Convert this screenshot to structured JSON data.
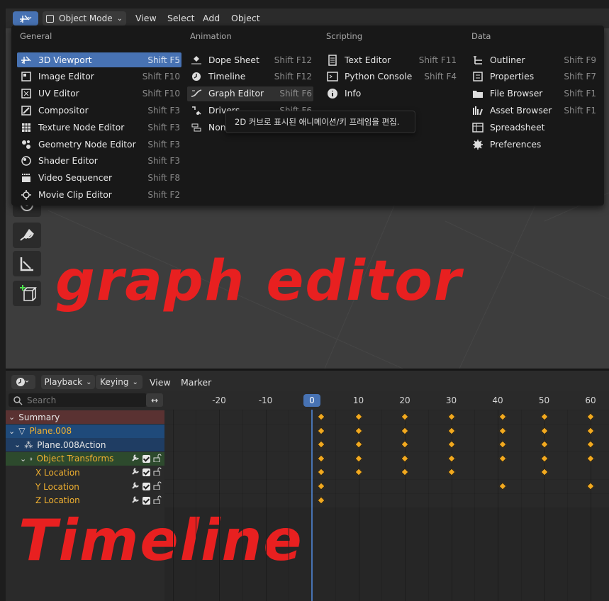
{
  "viewport_header": {
    "mode": "Object Mode",
    "menus": [
      "View",
      "Select",
      "Add",
      "Object"
    ]
  },
  "editor_menu": {
    "columns": [
      {
        "title": "General",
        "items": [
          {
            "label": "3D Viewport",
            "shortcut": "Shift F5",
            "icon": "3d-viewport-icon",
            "selected": true
          },
          {
            "label": "Image Editor",
            "shortcut": "Shift F10",
            "icon": "image-editor-icon"
          },
          {
            "label": "UV Editor",
            "shortcut": "Shift F10",
            "icon": "uv-editor-icon"
          },
          {
            "label": "Compositor",
            "shortcut": "Shift F3",
            "icon": "compositor-icon"
          },
          {
            "label": "Texture Node Editor",
            "shortcut": "Shift F3",
            "icon": "texture-node-icon"
          },
          {
            "label": "Geometry Node Editor",
            "shortcut": "Shift F3",
            "icon": "geometry-node-icon"
          },
          {
            "label": "Shader Editor",
            "shortcut": "Shift F3",
            "icon": "shader-editor-icon"
          },
          {
            "label": "Video Sequencer",
            "shortcut": "Shift F8",
            "icon": "video-sequencer-icon"
          },
          {
            "label": "Movie Clip Editor",
            "shortcut": "Shift F2",
            "icon": "movie-clip-icon"
          }
        ]
      },
      {
        "title": "Animation",
        "items": [
          {
            "label": "Dope Sheet",
            "shortcut": "Shift F12",
            "icon": "dope-sheet-icon"
          },
          {
            "label": "Timeline",
            "shortcut": "Shift F12",
            "icon": "timeline-icon"
          },
          {
            "label": "Graph Editor",
            "shortcut": "Shift F6",
            "icon": "graph-editor-icon",
            "hovered": true
          },
          {
            "label": "Drivers",
            "shortcut": "Shift F6",
            "icon": "drivers-icon"
          },
          {
            "label": "Nonlinear Animation",
            "shortcut": "",
            "icon": "nla-icon"
          }
        ]
      },
      {
        "title": "Scripting",
        "items": [
          {
            "label": "Text Editor",
            "shortcut": "Shift F11",
            "icon": "text-editor-icon"
          },
          {
            "label": "Python Console",
            "shortcut": "Shift F4",
            "icon": "python-console-icon"
          },
          {
            "label": "Info",
            "shortcut": "",
            "icon": "info-icon"
          }
        ]
      },
      {
        "title": "Data",
        "items": [
          {
            "label": "Outliner",
            "shortcut": "Shift F9",
            "icon": "outliner-icon"
          },
          {
            "label": "Properties",
            "shortcut": "Shift F7",
            "icon": "properties-icon"
          },
          {
            "label": "File Browser",
            "shortcut": "Shift F1",
            "icon": "file-browser-icon"
          },
          {
            "label": "Asset Browser",
            "shortcut": "Shift F1",
            "icon": "asset-browser-icon"
          },
          {
            "label": "Spreadsheet",
            "shortcut": "",
            "icon": "spreadsheet-icon"
          },
          {
            "label": "Preferences",
            "shortcut": "",
            "icon": "preferences-icon"
          }
        ]
      }
    ],
    "tooltip": "2D 커브로 표시된 애니메이션/키 프레임을 편집."
  },
  "annotations": {
    "graph_editor": "graph editor",
    "timeline": "Timeline"
  },
  "timeline_header": {
    "menus": [
      "Playback",
      "Keying",
      "View",
      "Marker"
    ]
  },
  "timeline": {
    "search_placeholder": "Search",
    "current_frame": "0",
    "ruler": [
      "-20",
      "-10",
      "0",
      "10",
      "20",
      "30",
      "40",
      "50",
      "60"
    ],
    "channels": [
      {
        "label": "Summary",
        "level": 0,
        "kind": "summary"
      },
      {
        "label": "Plane.008",
        "level": 0,
        "kind": "object"
      },
      {
        "label": "Plane.008Action",
        "level": 1,
        "kind": "action"
      },
      {
        "label": "Object Transforms",
        "level": 2,
        "kind": "group"
      },
      {
        "label": "X Location",
        "level": 3,
        "kind": "fcurve"
      },
      {
        "label": "Y Location",
        "level": 3,
        "kind": "fcurve"
      },
      {
        "label": "Z Location",
        "level": 3,
        "kind": "fcurve"
      }
    ],
    "keyframes": {
      "Summary": [
        2,
        10,
        20,
        30,
        41,
        50,
        60
      ],
      "Plane.008": [
        2,
        10,
        20,
        30,
        41,
        50,
        60
      ],
      "Plane.008Action": [
        2,
        10,
        20,
        30,
        41,
        50,
        60
      ],
      "Object Transforms": [
        2,
        10,
        20,
        30,
        41,
        50,
        60
      ],
      "X Location": [
        2,
        10,
        20,
        30,
        50
      ],
      "Y Location": [
        2,
        41,
        60
      ],
      "Z Location": [
        2
      ]
    },
    "colors": {
      "keyframe": "#f2a91f",
      "playhead": "#4772b3",
      "selected_channel": "#e8a830"
    }
  }
}
